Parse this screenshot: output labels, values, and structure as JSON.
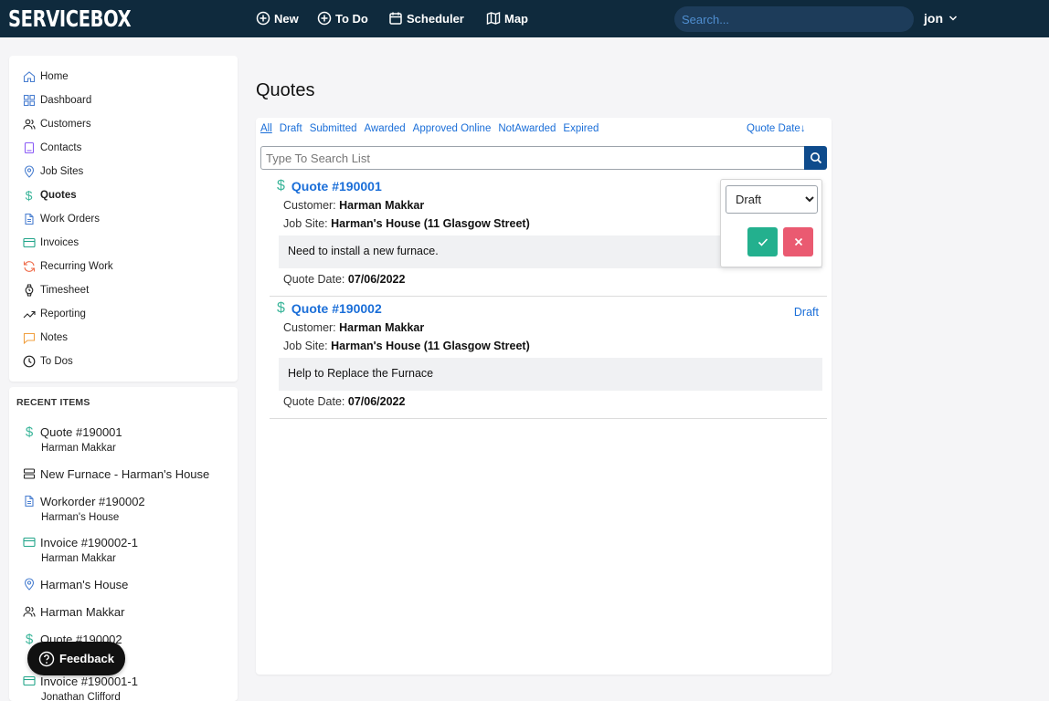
{
  "app": {
    "logo": "SERVICEBOX"
  },
  "topnav": {
    "new_label": "New",
    "todo_label": "To Do",
    "scheduler_label": "Scheduler",
    "map_label": "Map",
    "search_placeholder": "Search...",
    "user": "jon"
  },
  "sidebar": {
    "items": [
      {
        "label": "Home",
        "icon": "home-icon"
      },
      {
        "label": "Dashboard",
        "icon": "dashboard-icon"
      },
      {
        "label": "Customers",
        "icon": "users-icon"
      },
      {
        "label": "Contacts",
        "icon": "contact-card-icon"
      },
      {
        "label": "Job Sites",
        "icon": "map-pin-icon"
      },
      {
        "label": "Quotes",
        "icon": "dollar-icon"
      },
      {
        "label": "Work Orders",
        "icon": "document-icon"
      },
      {
        "label": "Invoices",
        "icon": "credit-card-icon"
      },
      {
        "label": "Recurring Work",
        "icon": "refresh-icon"
      },
      {
        "label": "Timesheet",
        "icon": "watch-icon"
      },
      {
        "label": "Reporting",
        "icon": "trending-up-icon"
      },
      {
        "label": "Notes",
        "icon": "note-icon"
      },
      {
        "label": "To Dos",
        "icon": "clock-icon"
      }
    ],
    "active": "Quotes"
  },
  "recent": {
    "title": "RECENT ITEMS",
    "items": [
      {
        "label": "Quote #190001",
        "sub": "Harman Makkar",
        "icon": "dollar-icon"
      },
      {
        "label": "New Furnace - Harman's House",
        "sub": "",
        "icon": "server-icon"
      },
      {
        "label": "Workorder #190002",
        "sub": "Harman's House",
        "icon": "document-icon"
      },
      {
        "label": "Invoice #190002-1",
        "sub": "Harman Makkar",
        "icon": "credit-card-icon"
      },
      {
        "label": "Harman's House",
        "sub": "",
        "icon": "map-pin-icon"
      },
      {
        "label": "Harman Makkar",
        "sub": "",
        "icon": "users-icon"
      },
      {
        "label": "Quote #190002",
        "sub": "",
        "icon": "dollar-icon"
      },
      {
        "label": "Invoice #190001-1",
        "sub": "Jonathan Clifford",
        "icon": "credit-card-icon"
      }
    ]
  },
  "feedback": {
    "label": "Feedback"
  },
  "main": {
    "title": "Quotes",
    "filters": [
      "All",
      "Draft",
      "Submitted",
      "Awarded",
      "Approved Online",
      "NotAwarded",
      "Expired"
    ],
    "active_filter": "All",
    "sort_label": "Quote Date↓",
    "search_placeholder": "Type To Search List",
    "quotes": [
      {
        "title": "Quote #190001",
        "customer_label": "Customer:",
        "customer": "Harman Makkar",
        "jobsite_label": "Job Site:",
        "jobsite": "Harman's House (11 Glasgow Street)",
        "note": "Need to install a new furnace.",
        "date_label": "Quote Date:",
        "date": "07/06/2022",
        "status": "Draft"
      },
      {
        "title": "Quote #190002",
        "customer_label": "Customer:",
        "customer": "Harman Makkar",
        "jobsite_label": "Job Site:",
        "jobsite": "Harman's House (11 Glasgow Street)",
        "note": "Help to Replace the Furnace",
        "date_label": "Quote Date:",
        "date": "07/06/2022",
        "status": "Draft"
      }
    ],
    "status_popover": {
      "selected": "Draft",
      "options": [
        "Draft"
      ]
    }
  },
  "colors": {
    "topbar": "#0f2a3d",
    "link": "#1a6ed8",
    "accent_green": "#23b08e",
    "accent_red": "#ea5a71",
    "search_button": "#0e4b8c"
  }
}
